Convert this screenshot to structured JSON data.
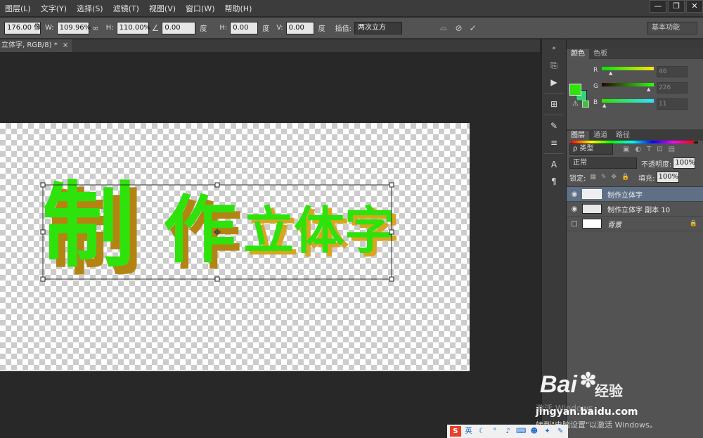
{
  "menu": [
    "图层(L)",
    "文字(Y)",
    "选择(S)",
    "滤镜(T)",
    "视图(V)",
    "窗口(W)",
    "帮助(H)"
  ],
  "window_buttons": [
    "—",
    "❐",
    "✕"
  ],
  "options": {
    "x_value": "176.00 像",
    "w_label": "W:",
    "w_value": "109.96%",
    "h_label": "H:",
    "h_value": "110.00%",
    "angle_value": "0.00",
    "angle_unit": "度",
    "hskew_label": "H:",
    "hskew_value": "0.00",
    "hskew_unit": "度",
    "vskew_label": "V:",
    "vskew_value": "0.00",
    "vskew_unit": "度",
    "interp_label": "插值:",
    "interp_value": "两次立方"
  },
  "workspace": "基本功能",
  "document_tab": {
    "title": "立体字, RGB/8) *",
    "close": "×"
  },
  "canvas_text": [
    "制",
    "作",
    "立体字"
  ],
  "color_panel": {
    "tabs": [
      "颜色",
      "色板"
    ],
    "r_label": "R",
    "g_label": "G",
    "b_label": "B",
    "r_value": "46",
    "g_value": "226",
    "b_value": "11",
    "fg_color": "#2ee20b"
  },
  "layers_panel": {
    "tabs": [
      "图层",
      "通道",
      "路径"
    ],
    "filter": "ρ 类型",
    "blend_mode": "正常",
    "opacity_label": "不透明度:",
    "opacity_value": "100%",
    "lock_label": "锁定:",
    "fill_label": "填充:",
    "fill_value": "100%",
    "layers": [
      {
        "name": "制作立体字",
        "visible": true,
        "selected": true
      },
      {
        "name": "制作立体字 副本 10",
        "visible": true,
        "selected": false
      },
      {
        "name": "背景",
        "visible": false,
        "selected": false,
        "locked": true
      }
    ]
  },
  "watermark": {
    "brand": "Bai",
    "brand_cn": "经验",
    "url": "jingyan.baidu.com"
  },
  "activate_line1": "激活 Windows",
  "activate_line2": "转到\"电脑设置\"以激活 Windows。",
  "ime": {
    "label": "英"
  }
}
